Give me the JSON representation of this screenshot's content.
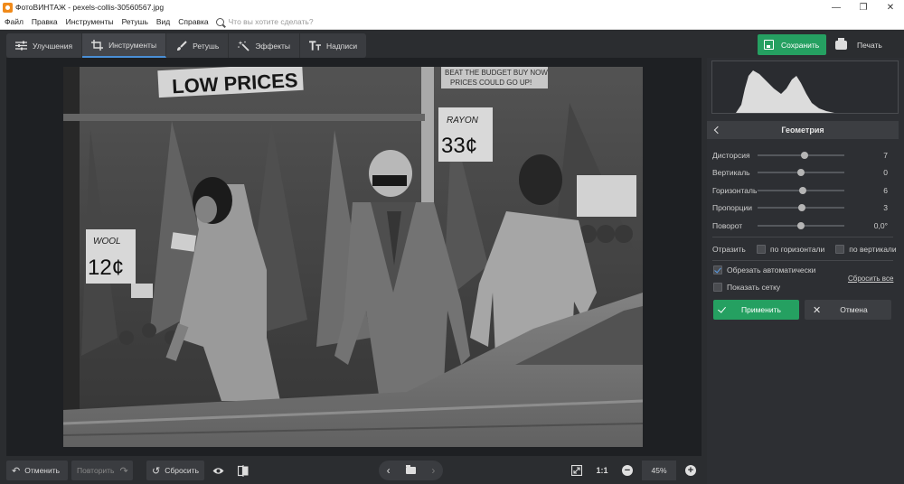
{
  "titlebar": {
    "title": "ФотоВИНТАЖ - pexels-collis-30560567.jpg"
  },
  "menu": {
    "items": [
      "Файл",
      "Правка",
      "Инструменты",
      "Ретушь",
      "Вид",
      "Справка"
    ],
    "search_placeholder": "Что вы хотите сделать?"
  },
  "tabs": [
    {
      "label": "Улучшения",
      "icon": "sliders-icon"
    },
    {
      "label": "Инструменты",
      "icon": "crop-icon",
      "active": true
    },
    {
      "label": "Ретушь",
      "icon": "brush-icon"
    },
    {
      "label": "Эффекты",
      "icon": "magic-wand-icon"
    },
    {
      "label": "Надписи",
      "icon": "text-icon"
    }
  ],
  "actions": {
    "save_label": "Сохранить",
    "print_label": "Печать"
  },
  "photo": {
    "signs": [
      "LOW PRICES",
      "BEAT THE BUDGET BUY NOW",
      "PRICES COULD GO UP!",
      "RAYON",
      "33¢",
      "WOOL",
      "12¢"
    ]
  },
  "geometry": {
    "title": "Геометрия",
    "sliders": [
      {
        "label": "Дисторсия",
        "value": "7",
        "level": 0.54
      },
      {
        "label": "Вертикаль",
        "value": "0",
        "level": 0.5
      },
      {
        "label": "Горизонталь",
        "value": "6",
        "level": 0.52
      },
      {
        "label": "Пропорции",
        "value": "3",
        "level": 0.51
      },
      {
        "label": "Поворот",
        "value": "0,0°",
        "level": 0.5
      }
    ],
    "reflect_label": "Отразить",
    "reflect_horizontal": "по горизонтали",
    "reflect_vertical": "по вертикали",
    "auto_crop_label": "Обрезать автоматически",
    "auto_crop_checked": true,
    "show_grid_label": "Показать сетку",
    "show_grid_checked": false,
    "reset_all": "Сбросить все",
    "apply_label": "Применить",
    "cancel_label": "Отмена"
  },
  "bottom": {
    "undo_label": "Отменить",
    "redo_label": "Повторить",
    "reset_label": "Сбросить",
    "ratio_label": "1:1",
    "zoom": "45%"
  },
  "colors": {
    "accent_green": "#25a061",
    "tab_highlight": "#4a8fd6",
    "background": "#2b2d30"
  }
}
